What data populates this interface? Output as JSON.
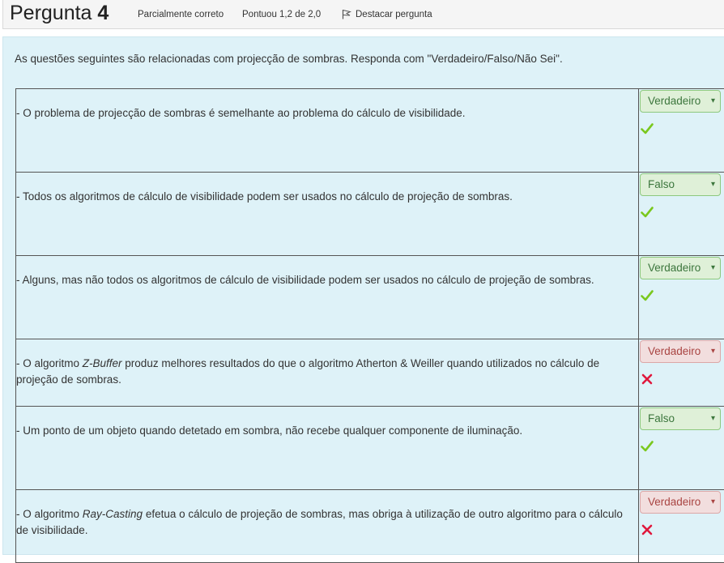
{
  "header": {
    "title_word": "Pergunta",
    "title_number": "4",
    "status": "Parcialmente correto",
    "score": "Pontuou 1,2 de 2,0",
    "flag_label": "Destacar pergunta"
  },
  "question": {
    "text": "As questões seguintes são relacionadas com projecção de sombras. Responda com \"Verdadeiro/Falso/Não Sei\"."
  },
  "rows": [
    {
      "pre": "- O problema de projecção de sombras é semelhante ao problema do cálculo de visibilidade.",
      "em": "",
      "post": "",
      "answer": "Verdadeiro",
      "result": "correct",
      "mark_icon": "check-icon"
    },
    {
      "pre": "- Todos os algoritmos de cálculo de visibilidade podem ser usados no cálculo de projeção de sombras.",
      "em": "",
      "post": "",
      "answer": "Falso",
      "result": "correct",
      "mark_icon": "check-icon"
    },
    {
      "pre": "- Alguns, mas não todos os algoritmos de cálculo de visibilidade podem ser usados no cálculo de projeção de sombras.",
      "em": "",
      "post": "",
      "answer": "Verdadeiro",
      "result": "correct",
      "mark_icon": "check-icon"
    },
    {
      "pre": "- O algoritmo ",
      "em": "Z-Buffer",
      "post": " produz melhores resultados do que o algoritmo Atherton & Weiller quando utilizados no cálculo de projeção de sombras.",
      "answer": "Verdadeiro",
      "result": "incorrect",
      "mark_icon": "cross-icon"
    },
    {
      "pre": "- Um ponto de um objeto quando detetado em sombra, não recebe qualquer componente de iluminação.",
      "em": "",
      "post": "",
      "answer": "Falso",
      "result": "correct",
      "mark_icon": "check-icon"
    },
    {
      "pre": "- O algoritmo ",
      "em": "Ray-Casting",
      "post": " efetua o cálculo de projeção de sombras, mas obriga à utilização de outro algoritmo para o cálculo de visibilidade.",
      "answer": "Verdadeiro",
      "result": "incorrect",
      "mark_icon": "cross-icon"
    }
  ],
  "colors": {
    "correct_check": "#7ac81e",
    "incorrect_cross": "#e0183c",
    "content_bg": "#def2f8"
  }
}
